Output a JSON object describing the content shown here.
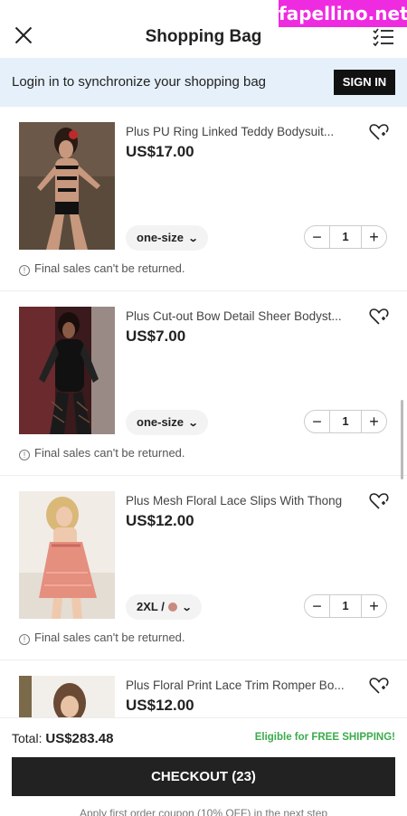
{
  "watermark": "fapellino.net",
  "header": {
    "title": "Shopping Bag"
  },
  "login_banner": {
    "text": "Login in to synchronize your shopping bag",
    "button_label": "SIGN IN"
  },
  "items": [
    {
      "name": "Plus PU Ring Linked Teddy Bodysuit...",
      "price": "US$17.00",
      "size": "one-size",
      "quantity": "1",
      "note": "Final sales can't be returned."
    },
    {
      "name": "Plus Cut-out Bow Detail Sheer Bodyst...",
      "price": "US$7.00",
      "size": "one-size",
      "quantity": "1",
      "note": "Final sales can't be returned."
    },
    {
      "name": "Plus Mesh Floral Lace Slips With Thong",
      "price": "US$12.00",
      "size": "2XL /",
      "swatch_color": "#c98a80",
      "quantity": "1",
      "note": "Final sales can't be returned."
    },
    {
      "name": "Plus Floral Print Lace Trim Romper Bo...",
      "price": "US$12.00"
    }
  ],
  "footer": {
    "total_label": "Total:",
    "total_value": "US$283.48",
    "free_shipping": "Eligible for FREE SHIPPING!",
    "checkout_label": "CHECKOUT (23)",
    "coupon_note": "Apply first order coupon (10% OFF) in the next step"
  },
  "colors": {
    "banner_bg": "#e6f0fa",
    "accent_green": "#3bab4c",
    "button_dark": "#222222",
    "watermark": "#ee2be0"
  },
  "icons": {
    "close": "close-icon",
    "list": "checklist-icon",
    "wishlist": "heart-add-icon",
    "info": "info-icon"
  }
}
